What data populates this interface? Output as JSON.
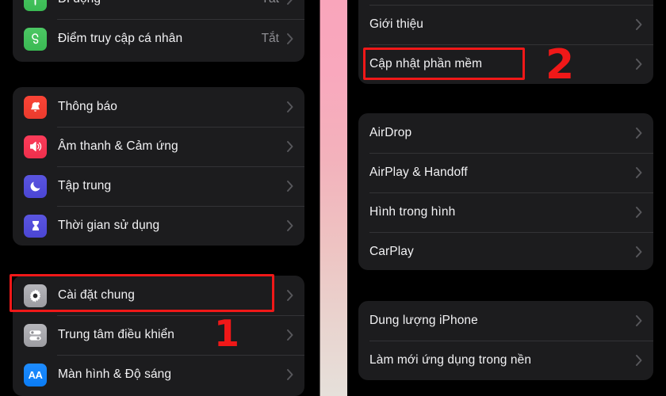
{
  "theme": {
    "background": "#000000",
    "card_background": "#1c1c1e",
    "label_color": "#f2f2f4",
    "value_color": "#8e8e93",
    "separator_color": "#333336",
    "highlight_color": "#f01818",
    "divider_gradient_top": "#f9a5bb",
    "divider_gradient_bottom": "#e6e0da"
  },
  "left_panel": {
    "groups": [
      {
        "name": "connectivity-group",
        "rows": [
          {
            "icon": "cellular-icon",
            "icon_color": "#4cc764",
            "label": "Di động",
            "value": "Tắt",
            "chevron": true
          },
          {
            "icon": "personal-hotspot-icon",
            "icon_color": "#4cc764",
            "label": "Điểm truy cập cá nhân",
            "value": "Tắt",
            "chevron": true
          }
        ]
      },
      {
        "name": "notifications-group",
        "rows": [
          {
            "icon": "bell-icon",
            "icon_color": "#fa4436",
            "label": "Thông báo",
            "value": "",
            "chevron": true
          },
          {
            "icon": "speaker-icon",
            "icon_color": "#fc3c5a",
            "label": "Âm thanh & Cảm ứng",
            "value": "",
            "chevron": true
          },
          {
            "icon": "moon-icon",
            "icon_color": "#5a55e0",
            "label": "Tập trung",
            "value": "",
            "chevron": true
          },
          {
            "icon": "hourglass-icon",
            "icon_color": "#5a55e0",
            "label": "Thời gian sử dụng",
            "value": "",
            "chevron": true
          }
        ]
      },
      {
        "name": "general-group",
        "rows": [
          {
            "icon": "gear-icon",
            "icon_color": "#b5b5ba",
            "label": "Cài đặt chung",
            "value": "",
            "chevron": true
          },
          {
            "icon": "control-center-icon",
            "icon_color": "#b5b5ba",
            "label": "Trung tâm điều khiển",
            "value": "",
            "chevron": true
          },
          {
            "icon": "display-brightness-icon",
            "icon_color": "#1e8cff",
            "label": "Màn hình & Độ sáng",
            "value": "",
            "chevron": true
          }
        ]
      }
    ],
    "annotation": {
      "step_number": "1",
      "highlighted_row_label": "Cài đặt chung"
    }
  },
  "right_panel": {
    "groups": [
      {
        "name": "about-group",
        "rows": [
          {
            "label": "Giới thiệu",
            "value": "",
            "chevron": true
          },
          {
            "label": "Cập nhật phần mềm",
            "value": "",
            "chevron": true
          }
        ]
      },
      {
        "name": "sharing-group",
        "rows": [
          {
            "label": "AirDrop",
            "value": "",
            "chevron": true
          },
          {
            "label": "AirPlay & Handoff",
            "value": "",
            "chevron": true
          },
          {
            "label": "Hình trong hình",
            "value": "",
            "chevron": true
          },
          {
            "label": "CarPlay",
            "value": "",
            "chevron": true
          }
        ]
      },
      {
        "name": "storage-group",
        "rows": [
          {
            "label": "Dung lượng iPhone",
            "value": "",
            "chevron": true
          },
          {
            "label": "Làm mới ứng dụng trong nền",
            "value": "",
            "chevron": true
          }
        ]
      }
    ],
    "annotation": {
      "step_number": "2",
      "highlighted_row_label": "Cập nhật phần mềm"
    }
  }
}
